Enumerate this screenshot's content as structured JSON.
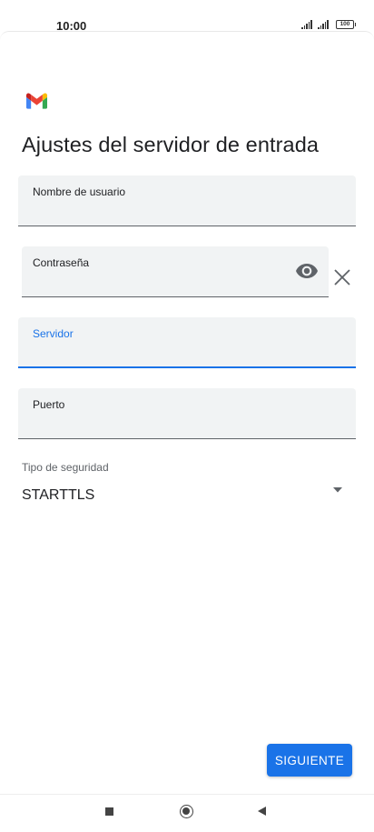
{
  "status_bar": {
    "time": "10:00",
    "battery": "100",
    "icons": [
      "signal-icon",
      "signal-icon",
      "battery-icon"
    ]
  },
  "app": {
    "logo": "gmail-logo",
    "title": "Ajustes del servidor de entrada"
  },
  "form": {
    "username": {
      "label": "Nombre de usuario",
      "value": ""
    },
    "password": {
      "label": "Contraseña",
      "value": "",
      "show_icon": "eye-icon",
      "clear_icon": "close-icon"
    },
    "server": {
      "label": "Servidor",
      "value": "",
      "focused": true
    },
    "port": {
      "label": "Puerto",
      "value": ""
    },
    "security": {
      "label": "Tipo de seguridad",
      "selected": "STARTTLS",
      "dropdown_icon": "chevron-down-icon"
    }
  },
  "actions": {
    "next_label": "SIGUIENTE"
  },
  "colors": {
    "accent": "#1a73e8",
    "field_bg": "#f1f3f4",
    "text": "#202124"
  },
  "nav_bar": {
    "icons": [
      "recents-icon",
      "home-icon",
      "back-icon"
    ]
  }
}
